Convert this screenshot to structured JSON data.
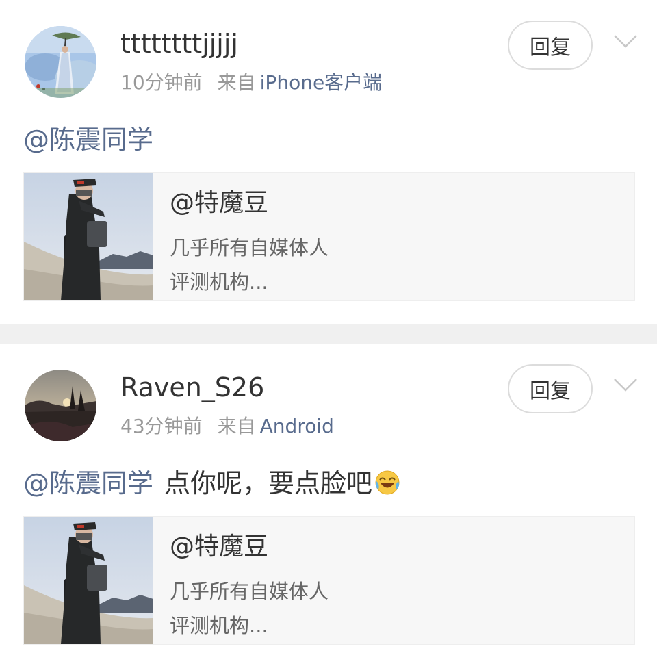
{
  "comments": [
    {
      "username": "ttttttttjjjjj",
      "time": "10分钟前",
      "source_label": "来自",
      "source": "iPhone客户端",
      "reply_label": "回复",
      "mention": "@陈震同学",
      "text": "",
      "emoji": "",
      "card": {
        "title": "@特魔豆",
        "desc_line1": "几乎所有自媒体人",
        "desc_line2": "评测机构..."
      }
    },
    {
      "username": "Raven_S26",
      "time": "43分钟前",
      "source_label": "来自",
      "source": "Android",
      "reply_label": "回复",
      "mention": "@陈震同学",
      "text": "点你呢，要点脸吧",
      "emoji": "laughing-crying-emoji",
      "card": {
        "title": "@特魔豆",
        "desc_line1": "几乎所有自媒体人",
        "desc_line2": "评测机构..."
      }
    }
  ],
  "colors": {
    "link": "#586b8d",
    "text": "#333333",
    "muted": "#999999",
    "divider": "#f0f0f0",
    "card_bg": "#f7f7f7"
  }
}
